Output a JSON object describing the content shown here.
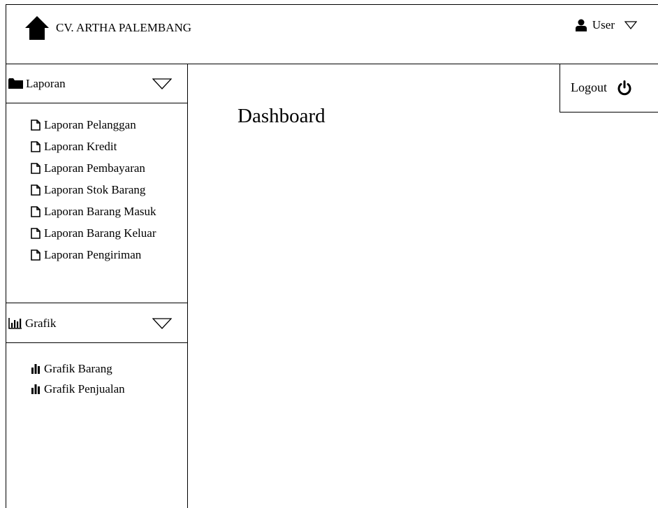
{
  "header": {
    "brand_title": "CV. ARTHA PALEMBANG",
    "user_label": "User"
  },
  "sidebar": {
    "laporan": {
      "label": "Laporan",
      "items": [
        "Laporan Pelanggan",
        "Laporan Kredit",
        "Laporan Pembayaran",
        "Laporan Stok Barang",
        "Laporan Barang Masuk",
        "Laporan Barang Keluar",
        "Laporan Pengiriman"
      ]
    },
    "grafik": {
      "label": "Grafik",
      "items": [
        "Grafik Barang",
        "Grafik Penjualan"
      ]
    }
  },
  "main": {
    "title": "Dashboard",
    "logout_label": "Logout"
  },
  "icons": {
    "brand": "home-icon",
    "user": "user-icon",
    "user_menu": "chevron-down-icon",
    "laporan": "folder-icon",
    "laporan_items": "file-icon",
    "grafik": "bar-chart-icon",
    "grafik_items": "bar-chart-icon",
    "logout": "power-icon"
  }
}
